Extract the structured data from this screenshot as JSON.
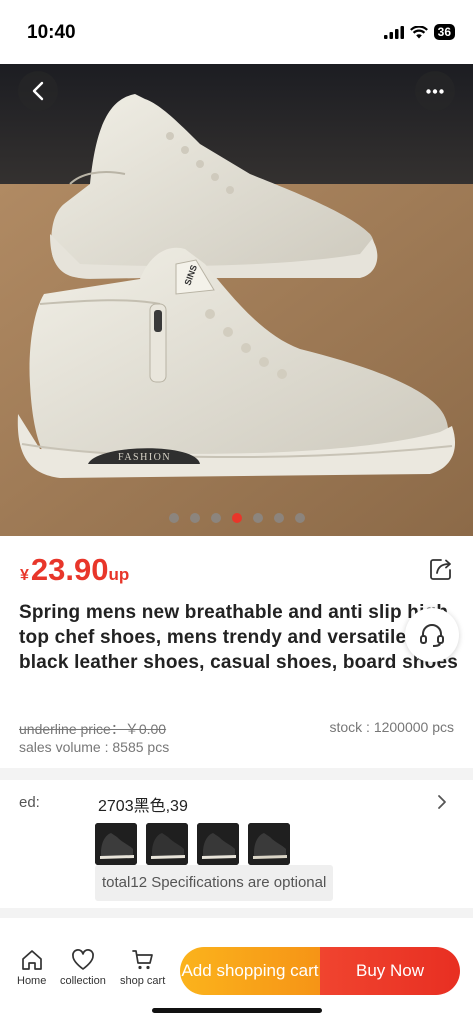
{
  "status_bar": {
    "time": "10:40",
    "battery": "36"
  },
  "gallery": {
    "image_count": 7,
    "active_index": 3,
    "sole_text": "FASHION",
    "tongue_text": "SINS"
  },
  "product": {
    "price_symbol": "¥",
    "price": "23.90",
    "price_suffix": "up",
    "title": "Spring mens new breathable and anti slip high top chef shoes, mens trendy and versatile black leather shoes, casual shoes, board shoes",
    "underline_price": "underline price：￥0.00",
    "stock": "stock : 1200000 pcs",
    "sales_volume": "sales volume : 8585 pcs"
  },
  "spec": {
    "label": "ed:",
    "selected": "2703黑色,39",
    "note": "total12 Specifications are optional"
  },
  "bottom_nav": {
    "home": "Home",
    "collection": "collection",
    "shop_cart": "shop cart",
    "add_cart": "Add shopping cart",
    "buy_now": "Buy Now"
  },
  "colors": {
    "accent": "#e8362a",
    "cart_button": "#f69416",
    "buy_button": "#e82f22"
  }
}
